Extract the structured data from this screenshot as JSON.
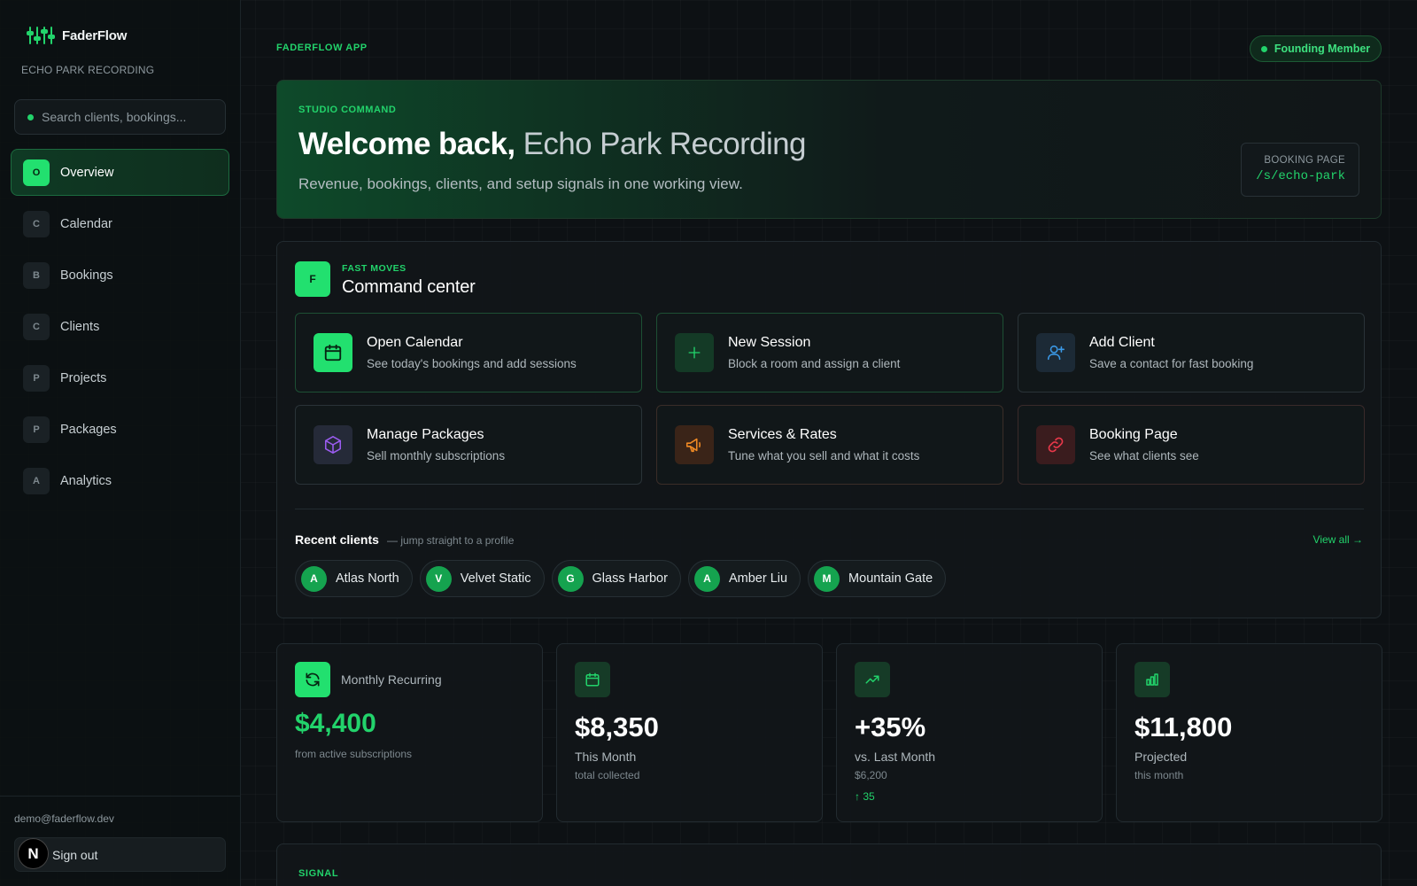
{
  "app": {
    "brand": "FaderFlow",
    "studio": "ECHO PARK RECORDING",
    "app_label": "FADERFLOW APP",
    "member_badge": "Founding Member"
  },
  "sidebar": {
    "search_placeholder": "Search clients, bookings...",
    "items": [
      {
        "badge": "O",
        "label": "Overview",
        "active": true
      },
      {
        "badge": "C",
        "label": "Calendar"
      },
      {
        "badge": "B",
        "label": "Bookings"
      },
      {
        "badge": "C",
        "label": "Clients"
      },
      {
        "badge": "P",
        "label": "Projects"
      },
      {
        "badge": "P",
        "label": "Packages"
      },
      {
        "badge": "A",
        "label": "Analytics"
      }
    ],
    "user_email": "demo@faderflow.dev",
    "signout_label": "Sign out",
    "overlay_logo": "N"
  },
  "hero": {
    "kicker": "STUDIO COMMAND",
    "title_strong": "Welcome back,",
    "title_light": "Echo Park Recording",
    "subtitle": "Revenue, bookings, clients, and setup signals in one working view.",
    "booking_label": "BOOKING PAGE",
    "booking_path": "/s/echo-park"
  },
  "command": {
    "badge": "F",
    "kicker": "FAST MOVES",
    "title": "Command center",
    "actions": [
      {
        "title": "Open Calendar",
        "desc": "See today's bookings and add sessions",
        "icon": "calendar-icon"
      },
      {
        "title": "New Session",
        "desc": "Block a room and assign a client",
        "icon": "plus-icon"
      },
      {
        "title": "Add Client",
        "desc": "Save a contact for fast booking",
        "icon": "user-plus-icon"
      },
      {
        "title": "Manage Packages",
        "desc": "Sell monthly subscriptions",
        "icon": "box-icon"
      },
      {
        "title": "Services & Rates",
        "desc": "Tune what you sell and what it costs",
        "icon": "megaphone-icon"
      },
      {
        "title": "Booking Page",
        "desc": "See what clients see",
        "icon": "link-icon"
      }
    ],
    "recent_title": "Recent clients",
    "recent_sub": "— jump straight to a profile",
    "view_all": "View all →",
    "clients": [
      {
        "initial": "A",
        "name": "Atlas North"
      },
      {
        "initial": "V",
        "name": "Velvet Static"
      },
      {
        "initial": "G",
        "name": "Glass Harbor"
      },
      {
        "initial": "A",
        "name": "Amber Liu"
      },
      {
        "initial": "M",
        "name": "Mountain Gate"
      }
    ]
  },
  "stats": {
    "mrr": {
      "label": "Monthly Recurring",
      "value": "$4,400",
      "foot": "from active subscriptions"
    },
    "month": {
      "value": "$8,350",
      "label": "This Month",
      "foot": "total collected"
    },
    "growth": {
      "value": "+35%",
      "label": "vs. Last Month",
      "foot": "$6,200",
      "delta": "↑ 35"
    },
    "projected": {
      "value": "$11,800",
      "label": "Projected",
      "foot": "this month"
    }
  },
  "signal": {
    "label": "SIGNAL"
  },
  "colors": {
    "accent": "#22d36b",
    "background": "#0d1114",
    "panel": "#111619"
  }
}
